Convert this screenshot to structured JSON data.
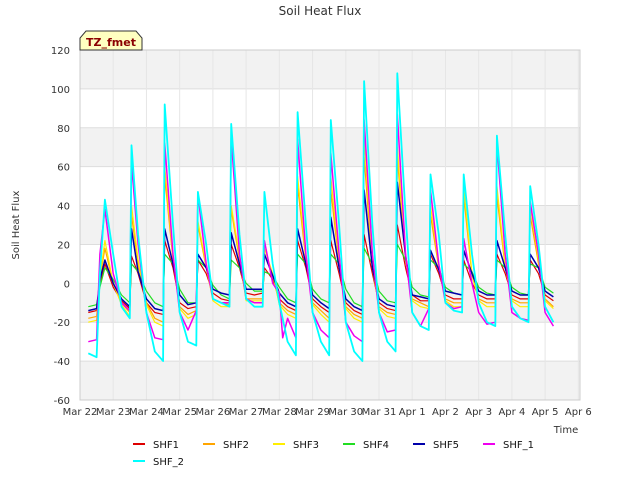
{
  "chart_data": {
    "type": "line",
    "title": "Soil Heat Flux",
    "xlabel": "Time",
    "ylabel": "Soil Heat Flux",
    "ylim": [
      -60,
      120
    ],
    "yticks": [
      -60,
      -40,
      -20,
      0,
      20,
      40,
      60,
      80,
      100,
      120
    ],
    "xlim": [
      0,
      15
    ],
    "xtick_labels": [
      "Mar 22",
      "Mar 23",
      "Mar 24",
      "Mar 25",
      "Mar 26",
      "Mar 27",
      "Mar 28",
      "Mar 29",
      "Mar 30",
      "Mar 31",
      "Apr 1",
      "Apr 2",
      "Apr 3",
      "Apr 4",
      "Apr 5",
      "Apr 6"
    ],
    "grid": true,
    "legend_position": "bottom",
    "annotation": "TZ_fmet",
    "x_units": "days since Mar 22",
    "series": [
      {
        "name": "SHF1",
        "color": "#dd0000",
        "width": 1.2,
        "x": [
          0.25,
          0.5,
          0.6,
          0.75,
          1.0,
          1.25,
          1.5,
          1.55,
          1.75,
          2.0,
          2.25,
          2.5,
          2.55,
          2.8,
          3.0,
          3.25,
          3.5,
          3.55,
          3.8,
          4.0,
          4.25,
          4.5,
          4.55,
          4.8,
          5.0,
          5.25,
          5.5,
          5.55,
          5.8,
          6.0,
          6.25,
          6.5,
          6.55,
          6.8,
          7.0,
          7.25,
          7.5,
          7.55,
          7.8,
          8.0,
          8.25,
          8.5,
          8.55,
          8.8,
          9.0,
          9.25,
          9.5,
          9.55,
          9.8,
          10.0,
          10.25,
          10.5,
          10.55,
          10.8,
          11.0,
          11.25,
          11.5,
          11.55,
          11.8,
          12.0,
          12.25,
          12.5,
          12.55,
          12.8,
          13.0,
          13.25,
          13.5,
          13.55,
          13.8,
          14.0,
          14.25
        ],
        "y": [
          -15,
          -14,
          0,
          10,
          -2,
          -9,
          -13,
          14,
          5,
          -10,
          -15,
          -16,
          22,
          8,
          -10,
          -13,
          -12,
          12,
          5,
          -5,
          -8,
          -9,
          20,
          8,
          -5,
          -6,
          -5,
          8,
          2,
          -8,
          -12,
          -14,
          22,
          8,
          -8,
          -12,
          -15,
          22,
          5,
          -10,
          -14,
          -16,
          25,
          5,
          -10,
          -13,
          -14,
          30,
          8,
          -6,
          -9,
          -9,
          15,
          5,
          -6,
          -8,
          -8,
          12,
          0,
          -6,
          -8,
          -8,
          15,
          5,
          -6,
          -8,
          -8,
          12,
          5,
          -6,
          -9
        ]
      },
      {
        "name": "SHF2",
        "color": "#ffa500",
        "width": 1.2,
        "x": [
          0.25,
          0.5,
          0.6,
          0.75,
          1.0,
          1.25,
          1.5,
          1.55,
          1.75,
          2.0,
          2.25,
          2.5,
          2.55,
          2.8,
          3.0,
          3.25,
          3.5,
          3.55,
          3.8,
          4.0,
          4.25,
          4.5,
          4.55,
          4.8,
          5.0,
          5.25,
          5.5,
          5.55,
          5.8,
          6.0,
          6.25,
          6.5,
          6.55,
          6.8,
          7.0,
          7.25,
          7.5,
          7.55,
          7.8,
          8.0,
          8.25,
          8.5,
          8.55,
          8.8,
          9.0,
          9.25,
          9.5,
          9.55,
          9.8,
          10.0,
          10.25,
          10.5,
          10.55,
          10.8,
          11.0,
          11.25,
          11.5,
          11.55,
          11.8,
          12.0,
          12.25,
          12.5,
          12.55,
          12.8,
          13.0,
          13.25,
          13.5,
          13.55,
          13.8,
          14.0,
          14.25
        ],
        "y": [
          -18,
          -17,
          2,
          18,
          0,
          -10,
          -15,
          35,
          10,
          -10,
          -18,
          -20,
          55,
          12,
          -12,
          -16,
          -14,
          30,
          8,
          -8,
          -10,
          -11,
          38,
          12,
          -8,
          -8,
          -8,
          15,
          4,
          -10,
          -14,
          -16,
          50,
          12,
          -10,
          -14,
          -18,
          48,
          10,
          -12,
          -16,
          -18,
          65,
          8,
          -12,
          -15,
          -16,
          65,
          12,
          -8,
          -10,
          -12,
          35,
          8,
          -8,
          -10,
          -10,
          45,
          4,
          -8,
          -10,
          -10,
          45,
          8,
          -8,
          -10,
          -10,
          35,
          10,
          -8,
          -12
        ]
      },
      {
        "name": "SHF3",
        "color": "#ffee00",
        "width": 1.2,
        "x": [
          0.25,
          0.5,
          0.6,
          0.75,
          1.0,
          1.25,
          1.5,
          1.55,
          1.75,
          2.0,
          2.25,
          2.5,
          2.55,
          2.8,
          3.0,
          3.25,
          3.5,
          3.55,
          3.8,
          4.0,
          4.25,
          4.5,
          4.55,
          4.8,
          5.0,
          5.25,
          5.5,
          5.55,
          5.8,
          6.0,
          6.25,
          6.5,
          6.55,
          6.8,
          7.0,
          7.25,
          7.5,
          7.55,
          7.8,
          8.0,
          8.25,
          8.5,
          8.55,
          8.8,
          9.0,
          9.25,
          9.5,
          9.55,
          9.8,
          10.0,
          10.25,
          10.5,
          10.55,
          10.8,
          11.0,
          11.25,
          11.5,
          11.55,
          11.8,
          12.0,
          12.25,
          12.5,
          12.55,
          12.8,
          13.0,
          13.25,
          13.5,
          13.55,
          13.8,
          14.0,
          14.25
        ],
        "y": [
          -20,
          -19,
          3,
          22,
          0,
          -11,
          -17,
          40,
          12,
          -11,
          -20,
          -22,
          60,
          14,
          -13,
          -18,
          -16,
          32,
          9,
          -9,
          -12,
          -12,
          40,
          14,
          -9,
          -9,
          -9,
          18,
          5,
          -11,
          -16,
          -18,
          55,
          14,
          -11,
          -16,
          -20,
          55,
          12,
          -13,
          -18,
          -20,
          75,
          10,
          -13,
          -17,
          -18,
          70,
          14,
          -9,
          -12,
          -13,
          40,
          9,
          -9,
          -12,
          -12,
          50,
          5,
          -9,
          -12,
          -12,
          50,
          9,
          -9,
          -12,
          -12,
          40,
          12,
          -9,
          -13
        ]
      },
      {
        "name": "SHF4",
        "color": "#22dd22",
        "width": 1.2,
        "x": [
          0.25,
          0.5,
          0.6,
          0.75,
          1.0,
          1.25,
          1.5,
          1.55,
          1.75,
          2.0,
          2.25,
          2.5,
          2.55,
          2.8,
          3.0,
          3.25,
          3.5,
          3.55,
          3.8,
          4.0,
          4.25,
          4.5,
          4.55,
          4.8,
          5.0,
          5.25,
          5.5,
          5.55,
          5.8,
          6.0,
          6.25,
          6.5,
          6.55,
          6.8,
          7.0,
          7.25,
          7.5,
          7.55,
          7.8,
          8.0,
          8.25,
          8.5,
          8.55,
          8.8,
          9.0,
          9.25,
          9.5,
          9.55,
          9.8,
          10.0,
          10.25,
          10.5,
          10.55,
          10.8,
          11.0,
          11.25,
          11.5,
          11.55,
          11.8,
          12.0,
          12.25,
          12.5,
          12.55,
          12.8,
          13.0,
          13.25,
          13.5,
          13.55,
          13.8,
          14.0,
          14.25
        ],
        "y": [
          -12,
          -11,
          -2,
          8,
          2,
          -6,
          -10,
          10,
          6,
          -4,
          -10,
          -12,
          15,
          10,
          -3,
          -10,
          -10,
          12,
          8,
          -1,
          -6,
          -8,
          12,
          8,
          0,
          -4,
          -4,
          6,
          4,
          -2,
          -8,
          -10,
          15,
          10,
          -3,
          -8,
          -10,
          15,
          10,
          -3,
          -10,
          -12,
          18,
          10,
          -4,
          -9,
          -10,
          20,
          12,
          -2,
          -6,
          -7,
          12,
          8,
          -2,
          -5,
          -6,
          10,
          6,
          -2,
          -5,
          -6,
          12,
          8,
          -2,
          -5,
          -6,
          10,
          8,
          -2,
          -5
        ]
      },
      {
        "name": "SHF5",
        "color": "#0000aa",
        "width": 1.5,
        "x": [
          0.25,
          0.5,
          0.6,
          0.75,
          1.0,
          1.25,
          1.5,
          1.55,
          1.75,
          2.0,
          2.25,
          2.5,
          2.55,
          2.8,
          3.0,
          3.25,
          3.5,
          3.55,
          3.8,
          4.0,
          4.25,
          4.5,
          4.55,
          4.8,
          5.0,
          5.25,
          5.5,
          5.55,
          5.8,
          6.0,
          6.25,
          6.5,
          6.55,
          6.8,
          7.0,
          7.25,
          7.5,
          7.55,
          7.8,
          8.0,
          8.25,
          8.5,
          8.55,
          8.8,
          9.0,
          9.25,
          9.5,
          9.55,
          9.8,
          10.0,
          10.25,
          10.5,
          10.55,
          10.8,
          11.0,
          11.25,
          11.5,
          11.55,
          11.8,
          12.0,
          12.25,
          12.5,
          12.55,
          12.8,
          13.0,
          13.25,
          13.5,
          13.55,
          13.8,
          14.0,
          14.25
        ],
        "y": [
          -14,
          -13,
          2,
          12,
          0,
          -8,
          -12,
          28,
          6,
          -8,
          -13,
          -14,
          28,
          10,
          -6,
          -11,
          -10,
          15,
          8,
          -3,
          -5,
          -6,
          26,
          10,
          -3,
          -3,
          -3,
          15,
          4,
          -5,
          -10,
          -12,
          28,
          10,
          -6,
          -10,
          -13,
          34,
          8,
          -8,
          -12,
          -14,
          48,
          8,
          -8,
          -11,
          -12,
          52,
          14,
          -6,
          -7,
          -8,
          17,
          7,
          -4,
          -5,
          -6,
          17,
          5,
          -4,
          -6,
          -6,
          22,
          8,
          -4,
          -6,
          -6,
          15,
          8,
          -4,
          -7
        ]
      },
      {
        "name": "SHF_1",
        "color": "#ee00ee",
        "width": 1.5,
        "x": [
          0.25,
          0.5,
          0.6,
          0.75,
          1.0,
          1.25,
          1.5,
          1.55,
          1.75,
          2.0,
          2.25,
          2.5,
          2.55,
          2.8,
          3.0,
          3.25,
          3.5,
          3.55,
          3.8,
          4.0,
          4.25,
          4.5,
          4.55,
          4.8,
          5.0,
          5.25,
          5.5,
          5.55,
          5.8,
          6.0,
          6.1,
          6.25,
          6.5,
          6.55,
          6.8,
          7.0,
          7.25,
          7.5,
          7.55,
          7.8,
          8.0,
          8.25,
          8.5,
          8.55,
          8.8,
          9.0,
          9.25,
          9.5,
          9.55,
          9.8,
          10.0,
          10.25,
          10.5,
          10.55,
          10.8,
          11.0,
          11.25,
          11.5,
          11.55,
          11.8,
          12.0,
          12.25,
          12.5,
          12.55,
          12.8,
          13.0,
          13.25,
          13.5,
          13.55,
          13.8,
          14.0,
          14.25
        ],
        "y": [
          -30,
          -29,
          15,
          38,
          5,
          -10,
          -14,
          62,
          20,
          -15,
          -28,
          -29,
          72,
          15,
          -15,
          -24,
          -14,
          46,
          10,
          -8,
          -10,
          -10,
          75,
          15,
          -8,
          -10,
          -10,
          22,
          0,
          -5,
          -28,
          -18,
          -28,
          74,
          15,
          -15,
          -24,
          -28,
          67,
          15,
          -20,
          -27,
          -30,
          84,
          15,
          -15,
          -25,
          -24,
          87,
          15,
          -15,
          -22,
          -13,
          48,
          10,
          -10,
          -13,
          -12,
          23,
          0,
          -15,
          -21,
          -20,
          72,
          15,
          -15,
          -18,
          -19,
          42,
          15,
          -15,
          -22
        ]
      },
      {
        "name": "SHF_2",
        "color": "#00ffff",
        "width": 1.8,
        "x": [
          0.25,
          0.5,
          0.6,
          0.75,
          1.0,
          1.25,
          1.5,
          1.55,
          1.75,
          2.0,
          2.25,
          2.5,
          2.55,
          2.8,
          3.0,
          3.25,
          3.5,
          3.55,
          3.8,
          4.0,
          4.25,
          4.5,
          4.55,
          4.8,
          5.0,
          5.25,
          5.5,
          5.55,
          5.8,
          6.0,
          6.25,
          6.5,
          6.55,
          6.8,
          7.0,
          7.25,
          7.5,
          7.55,
          7.8,
          8.0,
          8.25,
          8.5,
          8.55,
          8.8,
          9.0,
          9.25,
          9.5,
          9.55,
          9.8,
          10.0,
          10.25,
          10.5,
          10.55,
          10.8,
          11.0,
          11.25,
          11.5,
          11.55,
          11.8,
          12.0,
          12.25,
          12.5,
          12.55,
          12.8,
          13.0,
          13.25,
          13.5,
          13.55,
          13.8,
          14.0,
          14.25
        ],
        "y": [
          -36,
          -38,
          5,
          43,
          15,
          -12,
          -18,
          71,
          25,
          -15,
          -35,
          -40,
          92,
          30,
          -15,
          -30,
          -32,
          47,
          20,
          -8,
          -10,
          -12,
          82,
          25,
          -8,
          -12,
          -12,
          47,
          10,
          -10,
          -30,
          -37,
          88,
          30,
          -15,
          -30,
          -37,
          84,
          30,
          -20,
          -35,
          -40,
          104,
          30,
          -15,
          -30,
          -35,
          108,
          35,
          -15,
          -22,
          -24,
          56,
          25,
          -10,
          -14,
          -15,
          56,
          15,
          -10,
          -20,
          -22,
          76,
          25,
          -12,
          -18,
          -20,
          50,
          20,
          -12,
          -20
        ]
      }
    ]
  }
}
